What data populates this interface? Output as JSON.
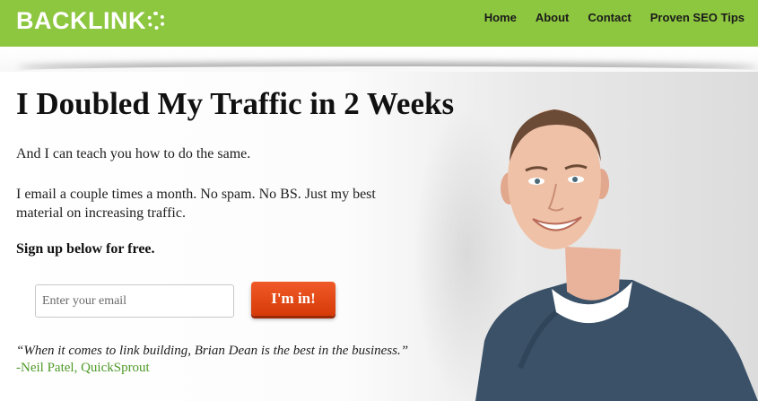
{
  "header": {
    "logo_text": "BACKLINK",
    "logo_o_icon": "dotted-o-logo-icon",
    "nav": [
      "Home",
      "About",
      "Contact",
      "Proven SEO Tips"
    ]
  },
  "hero": {
    "title": "I Doubled My Traffic in 2 Weeks",
    "subtitle": "And I can teach you how to do the same.",
    "body": "I email a couple times a month. No spam. No BS. Just my best material on increasing traffic.",
    "signup_prompt": "Sign up below for free.",
    "email_placeholder": "Enter your email",
    "cta_label": "I'm in!",
    "quote": "“When it comes to link building, Brian Dean is the best in the business.”",
    "quote_author": "-Neil Patel, QuickSprout"
  },
  "colors": {
    "header_bg": "#8dc63f",
    "cta_bg": "#e8491a",
    "cite_color": "#4f9a29"
  }
}
